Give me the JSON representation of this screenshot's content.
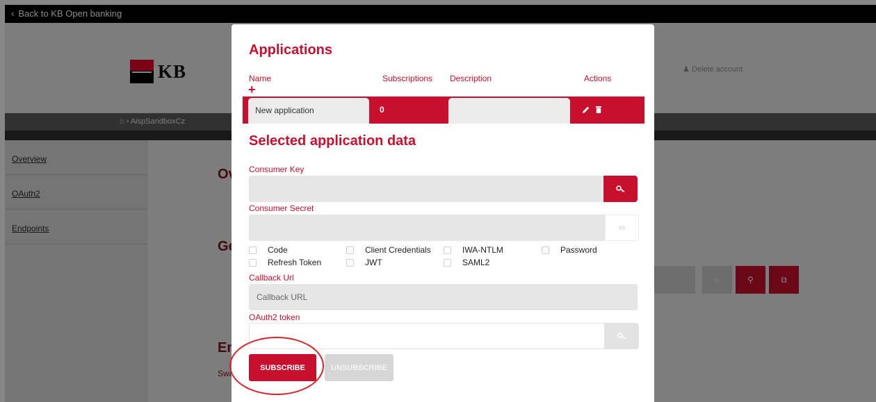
{
  "topbar": {
    "back_label": "Back to KB Open banking"
  },
  "header": {
    "logo_text": "KB",
    "delete_account_label": "Delete account"
  },
  "breadcrumb": {
    "current": "AispSandboxCz"
  },
  "sidebar": {
    "items": [
      {
        "label": "Overview"
      },
      {
        "label": "OAuth2"
      },
      {
        "label": "Endpoints"
      }
    ]
  },
  "background": {
    "heading_1": "Ov",
    "heading_2": "Ge",
    "heading_3": "En",
    "small_text": "Swa"
  },
  "modal": {
    "title": "Applications",
    "columns": {
      "name": "Name",
      "subscriptions": "Subscriptions",
      "description": "Description",
      "actions": "Actions"
    },
    "add_icon": "plus-icon",
    "application": {
      "name": "New application",
      "subscriptions": "0",
      "description": ""
    },
    "selected_title": "Selected application data",
    "consumer_key": {
      "label": "Consumer Key",
      "value": ""
    },
    "consumer_secret": {
      "label": "Consumer Secret",
      "value": ""
    },
    "grant_types": [
      {
        "label": "Code",
        "checked": false
      },
      {
        "label": "Client Credentials",
        "checked": false
      },
      {
        "label": "IWA-NTLM",
        "checked": false
      },
      {
        "label": "Password",
        "checked": false
      },
      {
        "label": "Refresh Token",
        "checked": false
      },
      {
        "label": "JWT",
        "checked": false
      },
      {
        "label": "SAML2",
        "checked": false
      }
    ],
    "callback": {
      "label": "Callback Url",
      "placeholder": "Callback URL",
      "value": ""
    },
    "oauth_token": {
      "label": "OAuth2 token",
      "value": ""
    },
    "subscribe_label": "SUBSCRIBE",
    "unsubscribe_label": "UNSUBSCRIBE"
  },
  "colors": {
    "accent": "#c8102e",
    "overlay": "rgba(0,0,0,0.47)",
    "annotation": "#d8232a"
  }
}
